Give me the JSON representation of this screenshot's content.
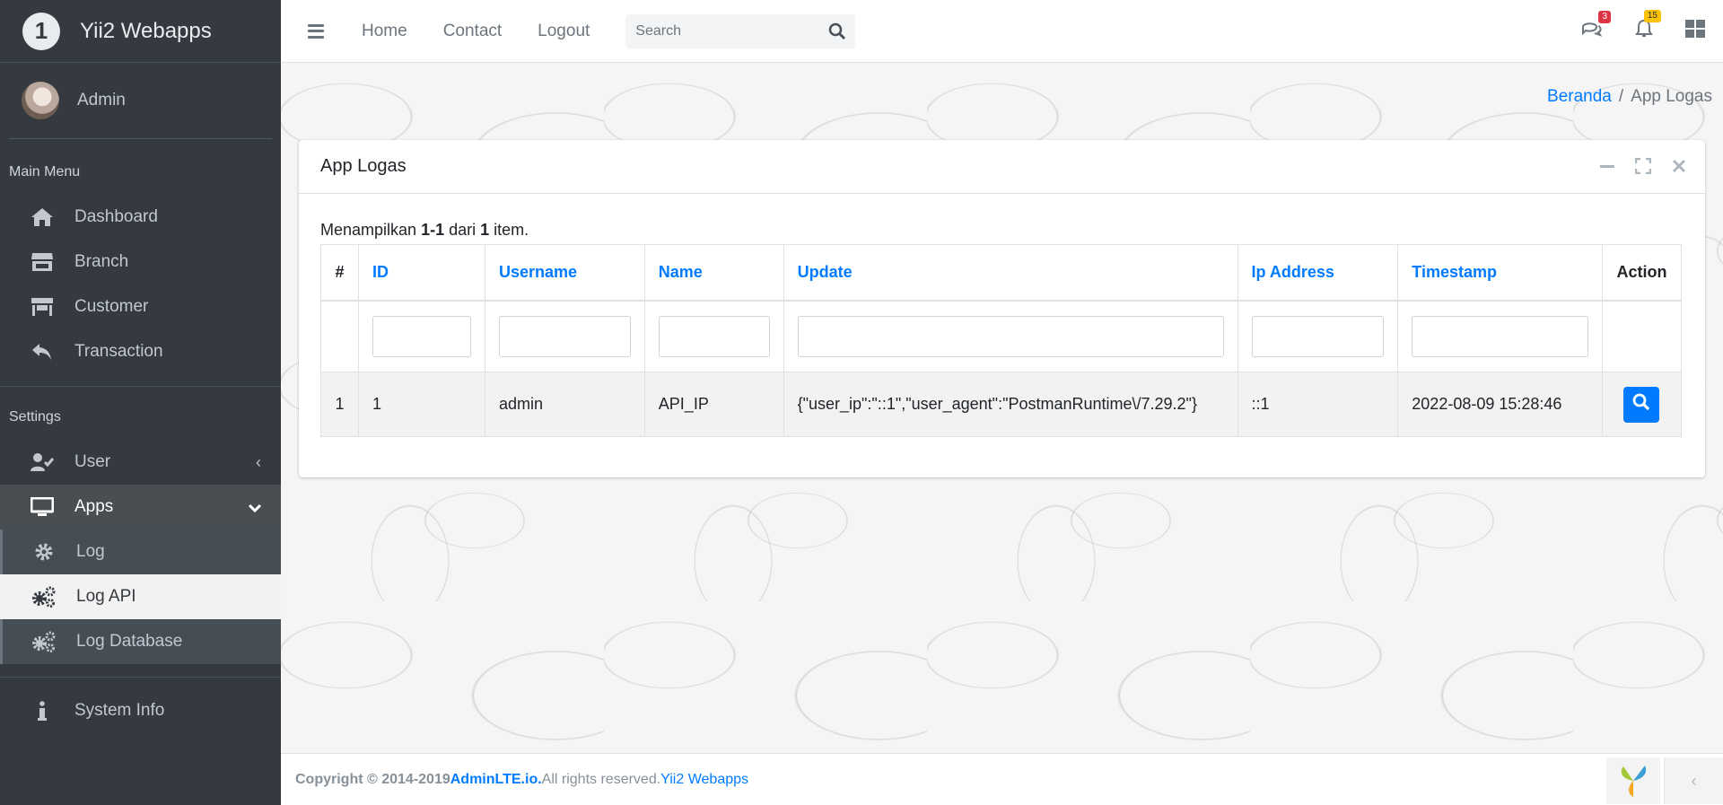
{
  "brand": {
    "logo_text": "1",
    "name": "Yii2 Webapps"
  },
  "user": {
    "name": "Admin"
  },
  "sidebar": {
    "main_header": "Main Menu",
    "main_items": [
      {
        "label": "Dashboard",
        "icon": "home-icon"
      },
      {
        "label": "Branch",
        "icon": "store-icon"
      },
      {
        "label": "Customer",
        "icon": "store-alt-icon"
      },
      {
        "label": "Transaction",
        "icon": "undo-icon"
      }
    ],
    "settings_header": "Settings",
    "settings_items": [
      {
        "label": "User",
        "icon": "user-check-icon",
        "caret": "‹"
      },
      {
        "label": "Apps",
        "icon": "desktop-icon",
        "caret": "⌄"
      },
      {
        "label": "Log",
        "icon": "cog-icon"
      },
      {
        "label": "Log API",
        "icon": "cogs-icon"
      },
      {
        "label": "Log Database",
        "icon": "cogs-icon"
      }
    ],
    "system_info": {
      "label": "System Info",
      "icon": "info-icon"
    }
  },
  "topbar": {
    "links": [
      "Home",
      "Contact",
      "Logout"
    ],
    "search_placeholder": "Search",
    "messages_badge": "3",
    "notifications_badge": "15"
  },
  "breadcrumb": {
    "home": "Beranda",
    "separator": "/",
    "current": "App Logas"
  },
  "card": {
    "title": "App Logas",
    "summary": {
      "prefix": "Menampilkan ",
      "range": "1-1",
      "middle": " dari ",
      "total": "1",
      "suffix": " item."
    }
  },
  "table": {
    "headers": [
      "#",
      "ID",
      "Username",
      "Name",
      "Update",
      "Ip Address",
      "Timestamp",
      "Action"
    ],
    "rows": [
      {
        "num": "1",
        "id": "1",
        "username": "admin",
        "name": "API_IP",
        "update": "{\"user_ip\":\"::1\",\"user_agent\":\"PostmanRuntime\\/7.29.2\"}",
        "ip": "::1",
        "timestamp": "2022-08-09 15:28:46"
      }
    ]
  },
  "footer": {
    "copyright": "Copyright © 2014-2019 ",
    "brand_link": "AdminLTE.io.",
    "rights": " All rights reserved. ",
    "app_link": "Yii2 Webapps"
  },
  "colors": {
    "sidebar": "#343a40",
    "accent": "#007bff",
    "danger": "#dc3545",
    "warning": "#ffc107"
  }
}
